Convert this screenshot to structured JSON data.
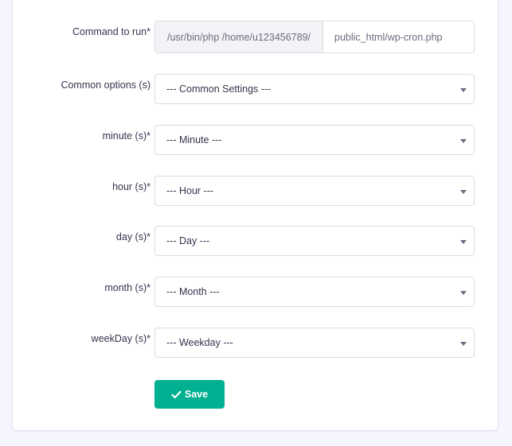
{
  "form": {
    "command": {
      "label": "Command to run*",
      "prefix": "/usr/bin/php /home/u123456789/",
      "value": "public_html/wp-cron.php"
    },
    "selects": [
      {
        "name": "common-options",
        "label": "Common options (s)",
        "selected": "--- Common Settings ---"
      },
      {
        "name": "minute",
        "label": "minute (s)*",
        "selected": "--- Minute ---"
      },
      {
        "name": "hour",
        "label": "hour (s)*",
        "selected": "--- Hour ---"
      },
      {
        "name": "day",
        "label": "day (s)*",
        "selected": "--- Day ---"
      },
      {
        "name": "month",
        "label": "month (s)*",
        "selected": "--- Month ---"
      },
      {
        "name": "weekday",
        "label": "weekDay (s)*",
        "selected": "--- Weekday ---"
      }
    ],
    "save_button": {
      "label": "Save",
      "icon": "check-icon",
      "color": "#00b090"
    }
  },
  "colors": {
    "page_background": "#f4f5ff",
    "card_background": "#ffffff",
    "prefix_background": "#f2f3f6",
    "text": "#36344d",
    "muted_text": "#6d6b80"
  }
}
